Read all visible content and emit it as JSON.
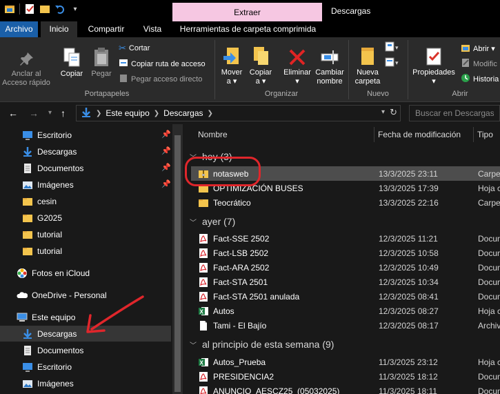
{
  "window": {
    "title": "Descargas",
    "contextual_tab": "Extraer"
  },
  "tabs": {
    "archivo": "Archivo",
    "inicio": "Inicio",
    "compartir": "Compartir",
    "vista": "Vista",
    "herramientas": "Herramientas de carpeta comprimida"
  },
  "ribbon": {
    "portapapeles": {
      "label": "Portapapeles",
      "anclar": "Anclar al\nAcceso rápido",
      "copiar": "Copiar",
      "pegar": "Pegar",
      "cortar": "Cortar",
      "copiar_ruta": "Copiar ruta de acceso",
      "pegar_acceso": "Pegar acceso directo"
    },
    "organizar": {
      "label": "Organizar",
      "mover": "Mover\na ▾",
      "copiar_a": "Copiar\na ▾",
      "eliminar": "Eliminar\n▾",
      "cambiar": "Cambiar\nnombre"
    },
    "nuevo": {
      "label": "Nuevo",
      "nueva_carpeta": "Nueva\ncarpeta"
    },
    "abrir": {
      "label": "Abrir",
      "propiedades": "Propiedades\n▾",
      "abrir": "Abrir ▾",
      "modificar": "Modific",
      "historial": "Historia"
    }
  },
  "address": {
    "crumbs": [
      "Este equipo",
      "Descargas"
    ],
    "search_placeholder": "Buscar en Descargas"
  },
  "navpane": {
    "items": [
      {
        "label": "Escritorio",
        "icon": "desktop-icon",
        "pinned": true
      },
      {
        "label": "Descargas",
        "icon": "download-icon",
        "pinned": true
      },
      {
        "label": "Documentos",
        "icon": "document-icon",
        "pinned": true
      },
      {
        "label": "Imágenes",
        "icon": "pictures-icon",
        "pinned": true
      },
      {
        "label": "cesin",
        "icon": "folder-icon",
        "pinned": false
      },
      {
        "label": "G2025",
        "icon": "folder-icon",
        "pinned": false
      },
      {
        "label": "tutorial",
        "icon": "folder-icon",
        "pinned": false
      },
      {
        "label": "tutorial",
        "icon": "folder-icon",
        "pinned": false
      },
      {
        "label": "Fotos en iCloud",
        "icon": "icloud-photos-icon",
        "pinned": false
      },
      {
        "label": "OneDrive - Personal",
        "icon": "onedrive-icon",
        "pinned": false
      },
      {
        "label": "Este equipo",
        "icon": "computer-icon",
        "pinned": false
      },
      {
        "label": "Descargas",
        "icon": "download-icon",
        "pinned": false,
        "selected": true
      },
      {
        "label": "Documentos",
        "icon": "document-icon",
        "pinned": false
      },
      {
        "label": "Escritorio",
        "icon": "desktop-icon",
        "pinned": false
      },
      {
        "label": "Imágenes",
        "icon": "pictures-icon",
        "pinned": false
      }
    ]
  },
  "filelist": {
    "columns": {
      "name": "Nombre",
      "date": "Fecha de modificación",
      "type": "Tipo"
    },
    "groups": [
      {
        "label": "hoy (3)",
        "rows": [
          {
            "name": "notasweb",
            "date": "13/3/2025 23:11",
            "type": "Carpet",
            "icon": "zip-folder-icon",
            "selected": true
          },
          {
            "name": "OPTIMIZACIÓN BUSES",
            "date": "13/3/2025 17:39",
            "type": "Hoja c",
            "icon": "folder-icon"
          },
          {
            "name": "Teocrático",
            "date": "13/3/2025 22:16",
            "type": "Carpet",
            "icon": "folder-icon"
          }
        ]
      },
      {
        "label": "ayer (7)",
        "rows": [
          {
            "name": "Fact-SSE 2502",
            "date": "12/3/2025 11:21",
            "type": "Docun",
            "icon": "pdf-icon"
          },
          {
            "name": "Fact-LSB 2502",
            "date": "12/3/2025 10:58",
            "type": "Docun",
            "icon": "pdf-icon"
          },
          {
            "name": "Fact-ARA 2502",
            "date": "12/3/2025 10:49",
            "type": "Docun",
            "icon": "pdf-icon"
          },
          {
            "name": "Fact-STA 2501",
            "date": "12/3/2025 10:34",
            "type": "Docun",
            "icon": "pdf-icon"
          },
          {
            "name": "Fact-STA 2501 anulada",
            "date": "12/3/2025 08:41",
            "type": "Docun",
            "icon": "pdf-icon"
          },
          {
            "name": "Autos",
            "date": "12/3/2025 08:27",
            "type": "Hoja c",
            "icon": "excel-icon"
          },
          {
            "name": "Tami - El Bajío",
            "date": "12/3/2025 08:17",
            "type": "Archiv",
            "icon": "file-icon"
          }
        ]
      },
      {
        "label": "al principio de esta semana (9)",
        "rows": [
          {
            "name": "Autos_Prueba",
            "date": "11/3/2025 23:12",
            "type": "Hoja c",
            "icon": "excel-icon"
          },
          {
            "name": "PRESIDENCIA2",
            "date": "11/3/2025 18:12",
            "type": "Docun",
            "icon": "pdf-icon"
          },
          {
            "name": "ANUNCIO_AESCZ25_(05032025)",
            "date": "11/3/2025 18:11",
            "type": "Docun",
            "icon": "pdf-icon"
          }
        ]
      }
    ]
  }
}
